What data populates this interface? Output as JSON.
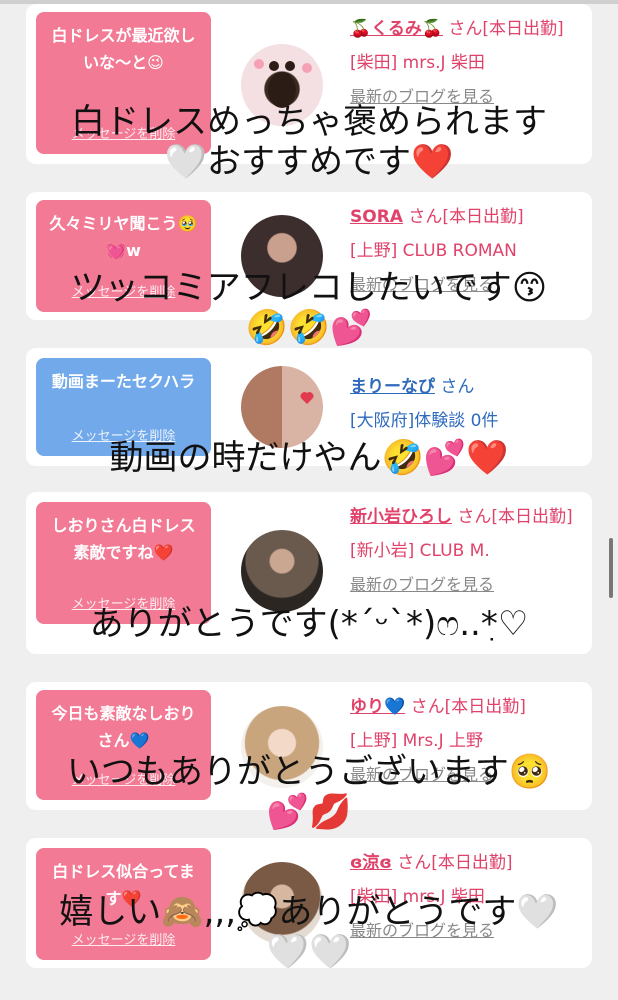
{
  "cards": [
    {
      "message": "白ドレスが最近欲しいな〜と😉",
      "delete_label": "メッセージを削除",
      "name": "🍒くるみ🍒",
      "san": "さん[本日出勤]",
      "shop": "[柴田] mrs.J 柴田",
      "blog": "最新のブログを見る",
      "overlay_lines": [
        "白ドレスめっちゃ褒められます",
        "🤍おすすめです❤️"
      ]
    },
    {
      "message": "久々ミリヤ聞こう🥹💓w",
      "delete_label": "メッセージを削除",
      "name": "SORA",
      "san": "さん[本日出勤]",
      "shop": "[上野] CLUB ROMAN",
      "blog": "最新のブログを見る",
      "overlay_lines": [
        "ツッコミアフレコしたいです😙",
        "🤣🤣💕"
      ]
    },
    {
      "message": "動画まーたセクハラ",
      "delete_label": "メッセージを削除",
      "name": "まりーなぴ",
      "san": "さん",
      "shop": "[大阪府]体験談 0件",
      "overlay_lines": [
        "動画の時だけやん🤣💕❤️"
      ]
    },
    {
      "message": "しおりさん白ドレス素敵ですね❤️",
      "delete_label": "メッセージを削除",
      "name": "新小岩ひろし",
      "san": "さん[本日出勤]",
      "shop": "[新小岩] CLUB M.",
      "blog": "最新のブログを見る",
      "overlay_lines": [
        "ありがとうです(*ˊᵕˋ*)ෆ..ִ*♡"
      ]
    },
    {
      "message": "今日も素敵なしおりさん💙",
      "delete_label": "メッセージを削除",
      "name": "ゆり💙",
      "san": "さん[本日出勤]",
      "shop": "[上野] Mrs.J 上野",
      "blog": "最新のブログを見る",
      "overlay_lines": [
        "いつもありがとうございます🥺",
        "💕💋"
      ]
    },
    {
      "message": "白ドレス似合ってます❤️",
      "delete_label": "メッセージを削除",
      "name": "ɞ涼ɞ",
      "san": "さん[本日出勤]",
      "shop": "[柴田] mrs.J 柴田",
      "blog": "最新のブログを見る",
      "overlay_lines": [
        "嬉しい🙈,,,💭ありがとうです🤍",
        "🤍🤍"
      ]
    }
  ]
}
